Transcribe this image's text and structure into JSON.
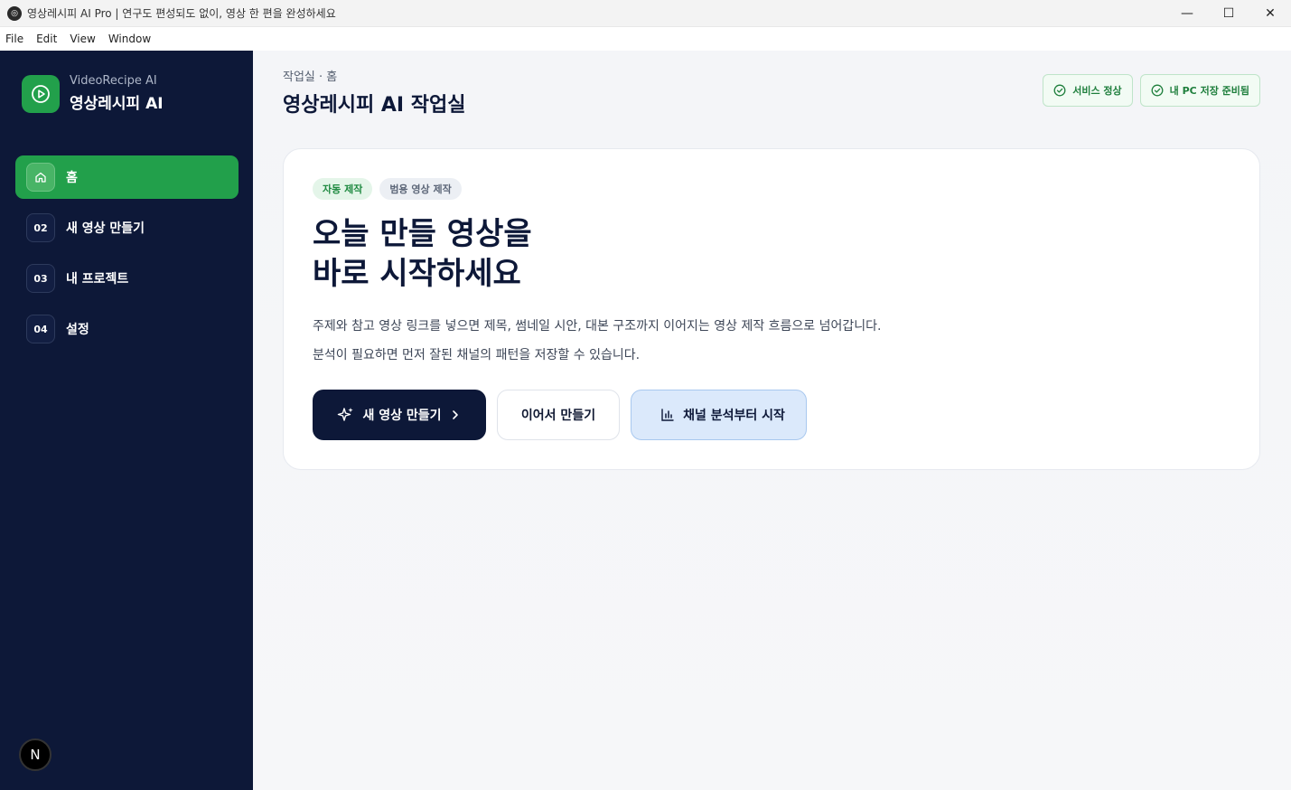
{
  "window": {
    "title": "영상레시피 AI Pro | 연구도 편성되도 없이, 영상 한 편을 완성하세요",
    "minimize": "—",
    "maximize": "☐",
    "close": "✕"
  },
  "menu": [
    "File",
    "Edit",
    "View",
    "Window"
  ],
  "brand": {
    "sub": "VideoRecipe AI",
    "main": "영상레시피 AI"
  },
  "nav": [
    {
      "badge": "",
      "label": "홈",
      "active": true
    },
    {
      "badge": "02",
      "label": "새 영상 만들기"
    },
    {
      "badge": "03",
      "label": "내 프로젝트"
    },
    {
      "badge": "04",
      "label": "설정"
    }
  ],
  "avatar": "N",
  "header": {
    "breadcrumb": "작업실 · 홈",
    "title": "영상레시피 AI 작업실",
    "status": [
      "서비스 정상",
      "내 PC 저장 준비됨"
    ]
  },
  "hero": {
    "tags": [
      "자동 제작",
      "범용 영상 제작"
    ],
    "headline_1": "오늘 만들 영상을",
    "headline_2": "바로 시작하세요",
    "desc_1": "주제와 참고 영상 링크를 넣으면 제목, 썸네일 시안, 대본 구조까지 이어지는 영상 제작 흐름으로 넘어갑니다.",
    "desc_2": "분석이 필요하면 먼저 잘된 채널의 패턴을 저장할 수 있습니다.",
    "btn_new": "새 영상 만들기",
    "btn_continue": "이어서 만들기",
    "btn_analyze": "채널 분석부터 시작"
  },
  "colors": {
    "sidebar": "#0d1838",
    "accent": "#22a04b",
    "primary_button": "#0d1838",
    "soft_button": "#dbe9fb"
  }
}
